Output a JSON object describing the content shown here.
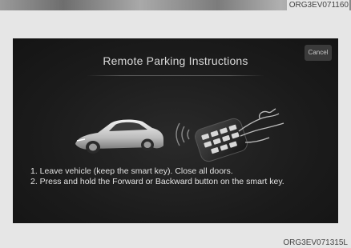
{
  "header_image": {
    "code_partial": "ORG3EV071160"
  },
  "screen": {
    "title": "Remote Parking Instructions",
    "cancel_label": "Cancel",
    "instructions": [
      "1. Leave vehicle (keep the smart key). Close all doors.",
      "2. Press and hold the Forward or Backward button on the smart key."
    ]
  },
  "figure_code": "ORG3EV071315L",
  "colors": {
    "screen_bg": "#1b1b1b",
    "text": "#e2e2e2",
    "page_bg": "#e6e6e6"
  }
}
